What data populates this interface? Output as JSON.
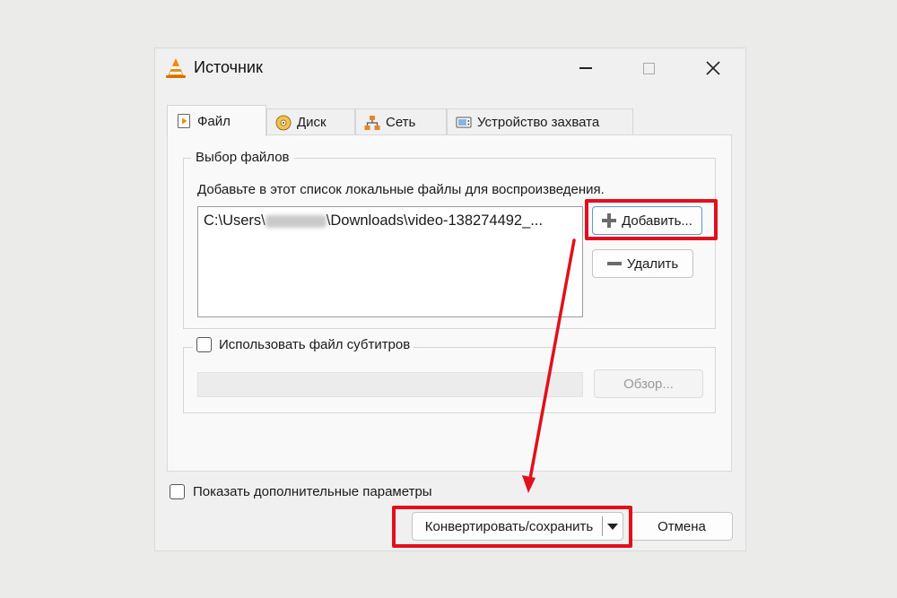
{
  "window": {
    "title": "Источник",
    "controls": {
      "minimize": "minimize-icon",
      "maximize": "maximize-icon",
      "close": "close-icon"
    }
  },
  "tabs": [
    {
      "label": "Файл",
      "icon": "file-play-icon",
      "active": true
    },
    {
      "label": "Диск",
      "icon": "disc-icon",
      "active": false
    },
    {
      "label": "Сеть",
      "icon": "network-icon",
      "active": false
    },
    {
      "label": "Устройство захвата",
      "icon": "capture-device-icon",
      "active": false
    }
  ],
  "file_selection": {
    "group_title": "Выбор файлов",
    "hint": "Добавьте в этот список локальные файлы для воспроизведения.",
    "files": [
      {
        "path_prefix": "C:\\Users\\",
        "path_suffix": "\\Downloads\\video-138274492_..."
      }
    ],
    "add_button": "Добавить...",
    "remove_button": "Удалить"
  },
  "subtitles": {
    "checkbox_label": "Использовать файл субтитров",
    "checked": false,
    "browse_button": "Обзор..."
  },
  "footer": {
    "show_more_label": "Показать дополнительные параметры",
    "convert_button": "Конвертировать/сохранить",
    "cancel_button": "Отмена"
  },
  "colors": {
    "highlight": "#e1101b",
    "accent_border": "#5d97d6",
    "vlc_orange": "#f08a10"
  }
}
